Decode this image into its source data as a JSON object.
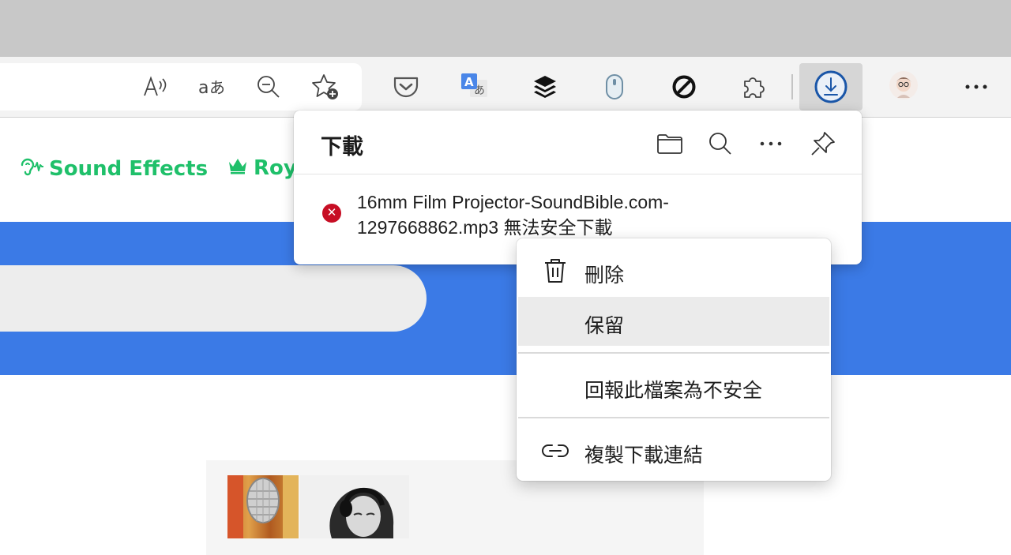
{
  "toolbar": {
    "icons": [
      "read-aloud-icon",
      "translate-text-icon",
      "zoom-out-icon",
      "add-favorite-icon",
      "pocket-icon",
      "google-translate-icon",
      "buffer-icon",
      "mouse-icon",
      "block-icon",
      "extensions-icon",
      "downloads-icon",
      "profile-avatar",
      "more-icon"
    ],
    "accent": "#1a56a8"
  },
  "page": {
    "nav_items": [
      {
        "label": "Sound Effects",
        "icon": "ear-icon"
      },
      {
        "label": "Roy",
        "icon": "crown-icon"
      }
    ],
    "nav_color": "#1fc06a",
    "hero_color": "#3b7ae6"
  },
  "downloads": {
    "title": "下載",
    "header_icons": [
      "folder-icon",
      "search-icon",
      "more-icon",
      "pin-icon"
    ],
    "item": {
      "status_icon": "error-icon",
      "status_color": "#c70e24",
      "text": "16mm Film Projector-SoundBible.com-1297668862.mp3 無法安全下載"
    }
  },
  "context_menu": {
    "items": [
      {
        "label": "刪除",
        "icon": "trash-icon"
      },
      {
        "label": "保留",
        "icon": ""
      },
      {
        "label": "回報此檔案為不安全",
        "icon": ""
      },
      {
        "label": "複製下載連結",
        "icon": "link-icon"
      }
    ]
  }
}
